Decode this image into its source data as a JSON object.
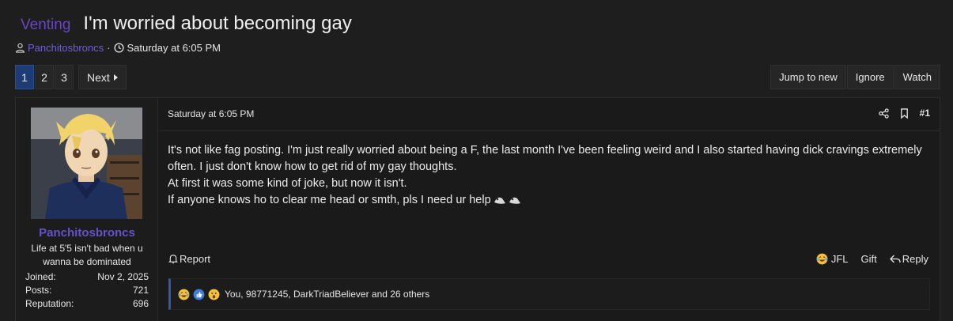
{
  "thread": {
    "prefix": "Venting",
    "title": "I'm worried about becoming gay",
    "author": "Panchitosbroncs",
    "separator": "·",
    "date": "Saturday at 6:05 PM"
  },
  "pagination": {
    "pages": [
      "1",
      "2",
      "3"
    ],
    "current": "1",
    "next_label": "Next"
  },
  "thread_actions": {
    "jump_label": "Jump to new",
    "ignore_label": "Ignore",
    "watch_label": "Watch"
  },
  "post": {
    "user": {
      "name": "Panchitosbroncs",
      "title": "Life at 5'5 isn't bad when u wanna be dominated",
      "stats": [
        {
          "label": "Joined:",
          "value": "Nov 2, 2025"
        },
        {
          "label": "Posts:",
          "value": "721"
        },
        {
          "label": "Reputation:",
          "value": "696"
        }
      ]
    },
    "date": "Saturday at 6:05 PM",
    "number": "#1",
    "body": [
      "It's not like fag posting. I'm just really worried about being a F, the last month I've been feeling weird and I also started having dick cravings extremely often. I just don't know how to get rid of my gay thoughts.",
      "At first it was some kind of joke, but now it isn't.",
      "If anyone knows ho to clear me head or smth, pls I need ur help"
    ],
    "report_label": "Report",
    "footer": {
      "react_label": "JFL",
      "gift_label": "Gift",
      "reply_label": "Reply"
    },
    "reactions_text": "You, 98771245, DarkTriadBeliever and 26 others"
  },
  "icons": {
    "user": "user-icon",
    "clock": "clock-icon",
    "next": "caret-right-icon",
    "share": "share-icon",
    "bookmark": "bookmark-icon",
    "bell": "bell-icon",
    "laugh": "laughing-emoji-icon",
    "like": "thumbs-up-icon",
    "wow": "shocked-emoji-icon",
    "reply": "reply-arrow-icon"
  },
  "colors": {
    "accent": "#6647c4",
    "username": "#6552c8",
    "active_page": "#1d3c75",
    "reaction_bar": "#2f57b0"
  }
}
